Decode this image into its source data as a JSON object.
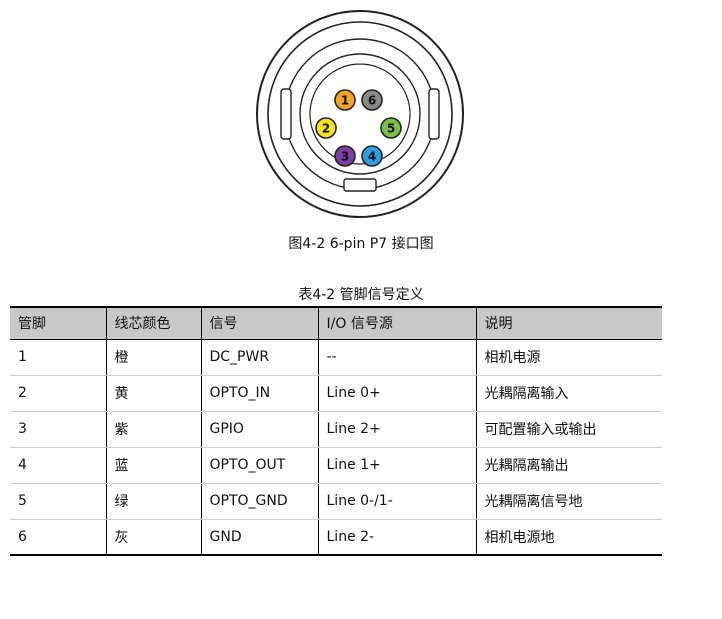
{
  "figure": {
    "caption": "图4-2  6-pin P7 接口图",
    "pins": [
      {
        "label": "1",
        "color": "#f5a623"
      },
      {
        "label": "6",
        "color": "#8a8a8a"
      },
      {
        "label": "2",
        "color": "#f2e21a"
      },
      {
        "label": "5",
        "color": "#7bc043"
      },
      {
        "label": "3",
        "color": "#7a3fa0"
      },
      {
        "label": "4",
        "color": "#2d9fe0"
      }
    ]
  },
  "table": {
    "caption": "表4-2  管脚信号定义",
    "headers": [
      "管脚",
      "线芯颜色",
      "信号",
      "I/O 信号源",
      "说明"
    ],
    "rows": [
      [
        "1",
        "橙",
        "DC_PWR",
        "--",
        "相机电源"
      ],
      [
        "2",
        "黄",
        "OPTO_IN",
        "Line 0+",
        "光耦隔离输入"
      ],
      [
        "3",
        "紫",
        "GPIO",
        "Line 2+",
        "可配置输入或输出"
      ],
      [
        "4",
        "蓝",
        "OPTO_OUT",
        "Line 1+",
        "光耦隔离输出"
      ],
      [
        "5",
        "绿",
        "OPTO_GND",
        "Line 0-/1-",
        "光耦隔离信号地"
      ],
      [
        "6",
        "灰",
        "GND",
        "Line 2-",
        "相机电源地"
      ]
    ]
  }
}
